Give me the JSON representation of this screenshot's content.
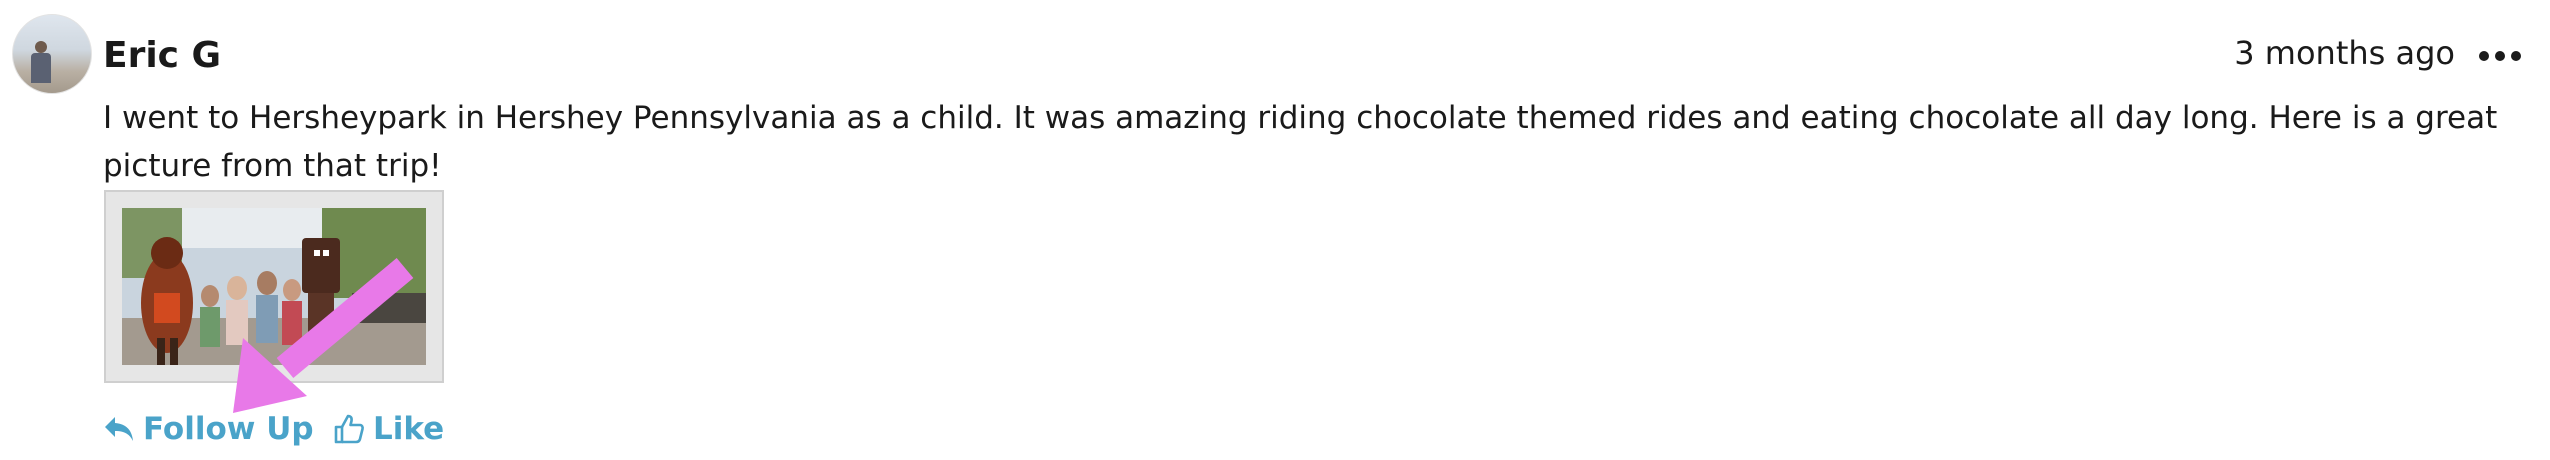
{
  "post": {
    "author": "Eric G",
    "timestamp": "3 months ago",
    "more_icon": "more-horizontal-icon",
    "body": "I went to Hersheypark in Hershey Pennsylvania as a child. It was amazing riding chocolate themed rides and eating chocolate all day long. Here is a great picture from that trip!",
    "attachment": {
      "kind": "photo"
    }
  },
  "actions": {
    "follow_up_label": "Follow Up",
    "follow_up_icon": "reply-icon",
    "like_label": "Like",
    "like_icon": "thumbs-up-icon"
  },
  "colors": {
    "link": "#4aa3c9",
    "text": "#1a1a1a",
    "annotation_arrow": "#e879e8"
  }
}
